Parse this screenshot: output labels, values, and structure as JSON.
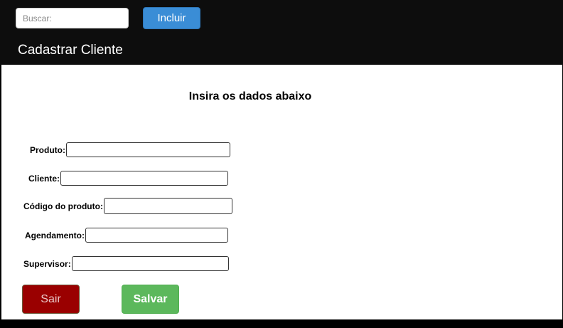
{
  "header": {
    "search": {
      "placeholder": "Buscar:",
      "value": ""
    },
    "include_button_label": "Incluir",
    "page_title": "Cadastrar Cliente"
  },
  "form": {
    "heading": "Insira os dados abaixo",
    "fields": [
      {
        "label": "Produto:",
        "value": ""
      },
      {
        "label": "Cliente:",
        "value": ""
      },
      {
        "label": "Código do produto:",
        "value": ""
      },
      {
        "label": "Agendamento:",
        "value": ""
      },
      {
        "label": "Supervisor:",
        "value": ""
      }
    ],
    "exit_button_label": "Sair",
    "save_button_label": "Salvar"
  },
  "colors": {
    "background": "#000000",
    "include_button": "#3a8dd6",
    "exit_button": "#9a0000",
    "save_button": "#5cb85c"
  }
}
